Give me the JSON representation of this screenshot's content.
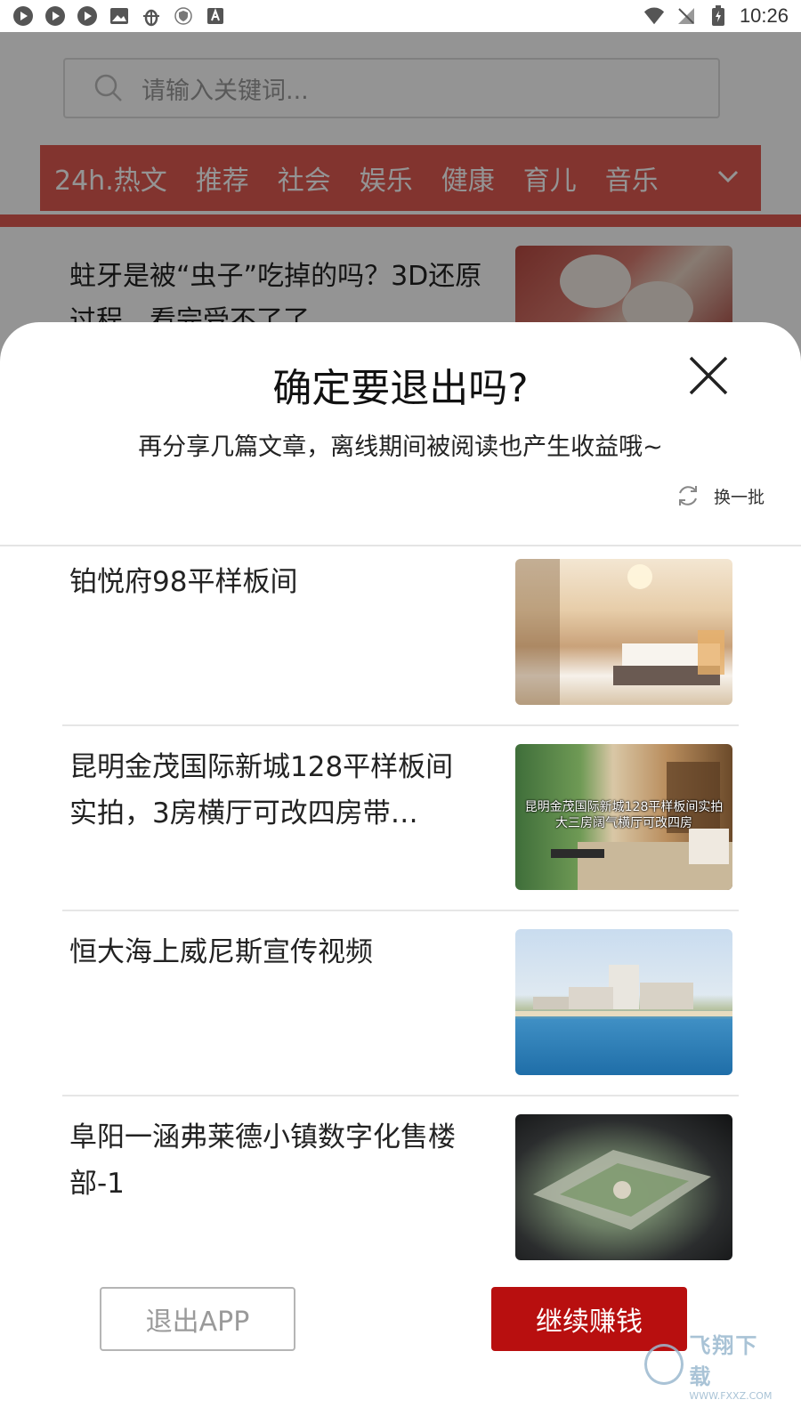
{
  "status_bar": {
    "time": "10:26",
    "left_icons": [
      "app-circle-icon",
      "app-circle-icon",
      "app-circle-icon",
      "image-icon",
      "bug-icon",
      "shield-icon",
      "font-a-icon"
    ],
    "right_icons": [
      "wifi-icon",
      "no-signal-icon",
      "battery-icon"
    ]
  },
  "background_app": {
    "search_placeholder": "请输入关键词...",
    "categories": [
      "24h.热文",
      "推荐",
      "社会",
      "娱乐",
      "健康",
      "育儿",
      "音乐"
    ],
    "accent_color": "#e05a52",
    "article_title": "蛀牙是被“虫子”吃掉的吗？3D还原过程，看完受不了了"
  },
  "dialog": {
    "title": "确定要退出吗?",
    "subtitle": "再分享几篇文章，离线期间被阅读也产生收益哦~",
    "refresh_label": "换一批",
    "articles": [
      {
        "title": "铂悦府98平样板间"
      },
      {
        "title": "昆明金茂国际新城128平样板间实拍，3房横厅可改四房带…",
        "thumb_caption": "昆明金茂国际新城128平样板间实拍大三房阔气横厅可改四房"
      },
      {
        "title": "恒大海上威尼斯宣传视频"
      },
      {
        "title": "阜阳一涵弗莱德小镇数字化售楼部-1"
      }
    ],
    "exit_button": "退出APP",
    "continue_button": "继续赚钱",
    "continue_color": "#b80f0f"
  },
  "watermark": {
    "name": "飞翔下载",
    "url": "WWW.FXXZ.COM"
  }
}
